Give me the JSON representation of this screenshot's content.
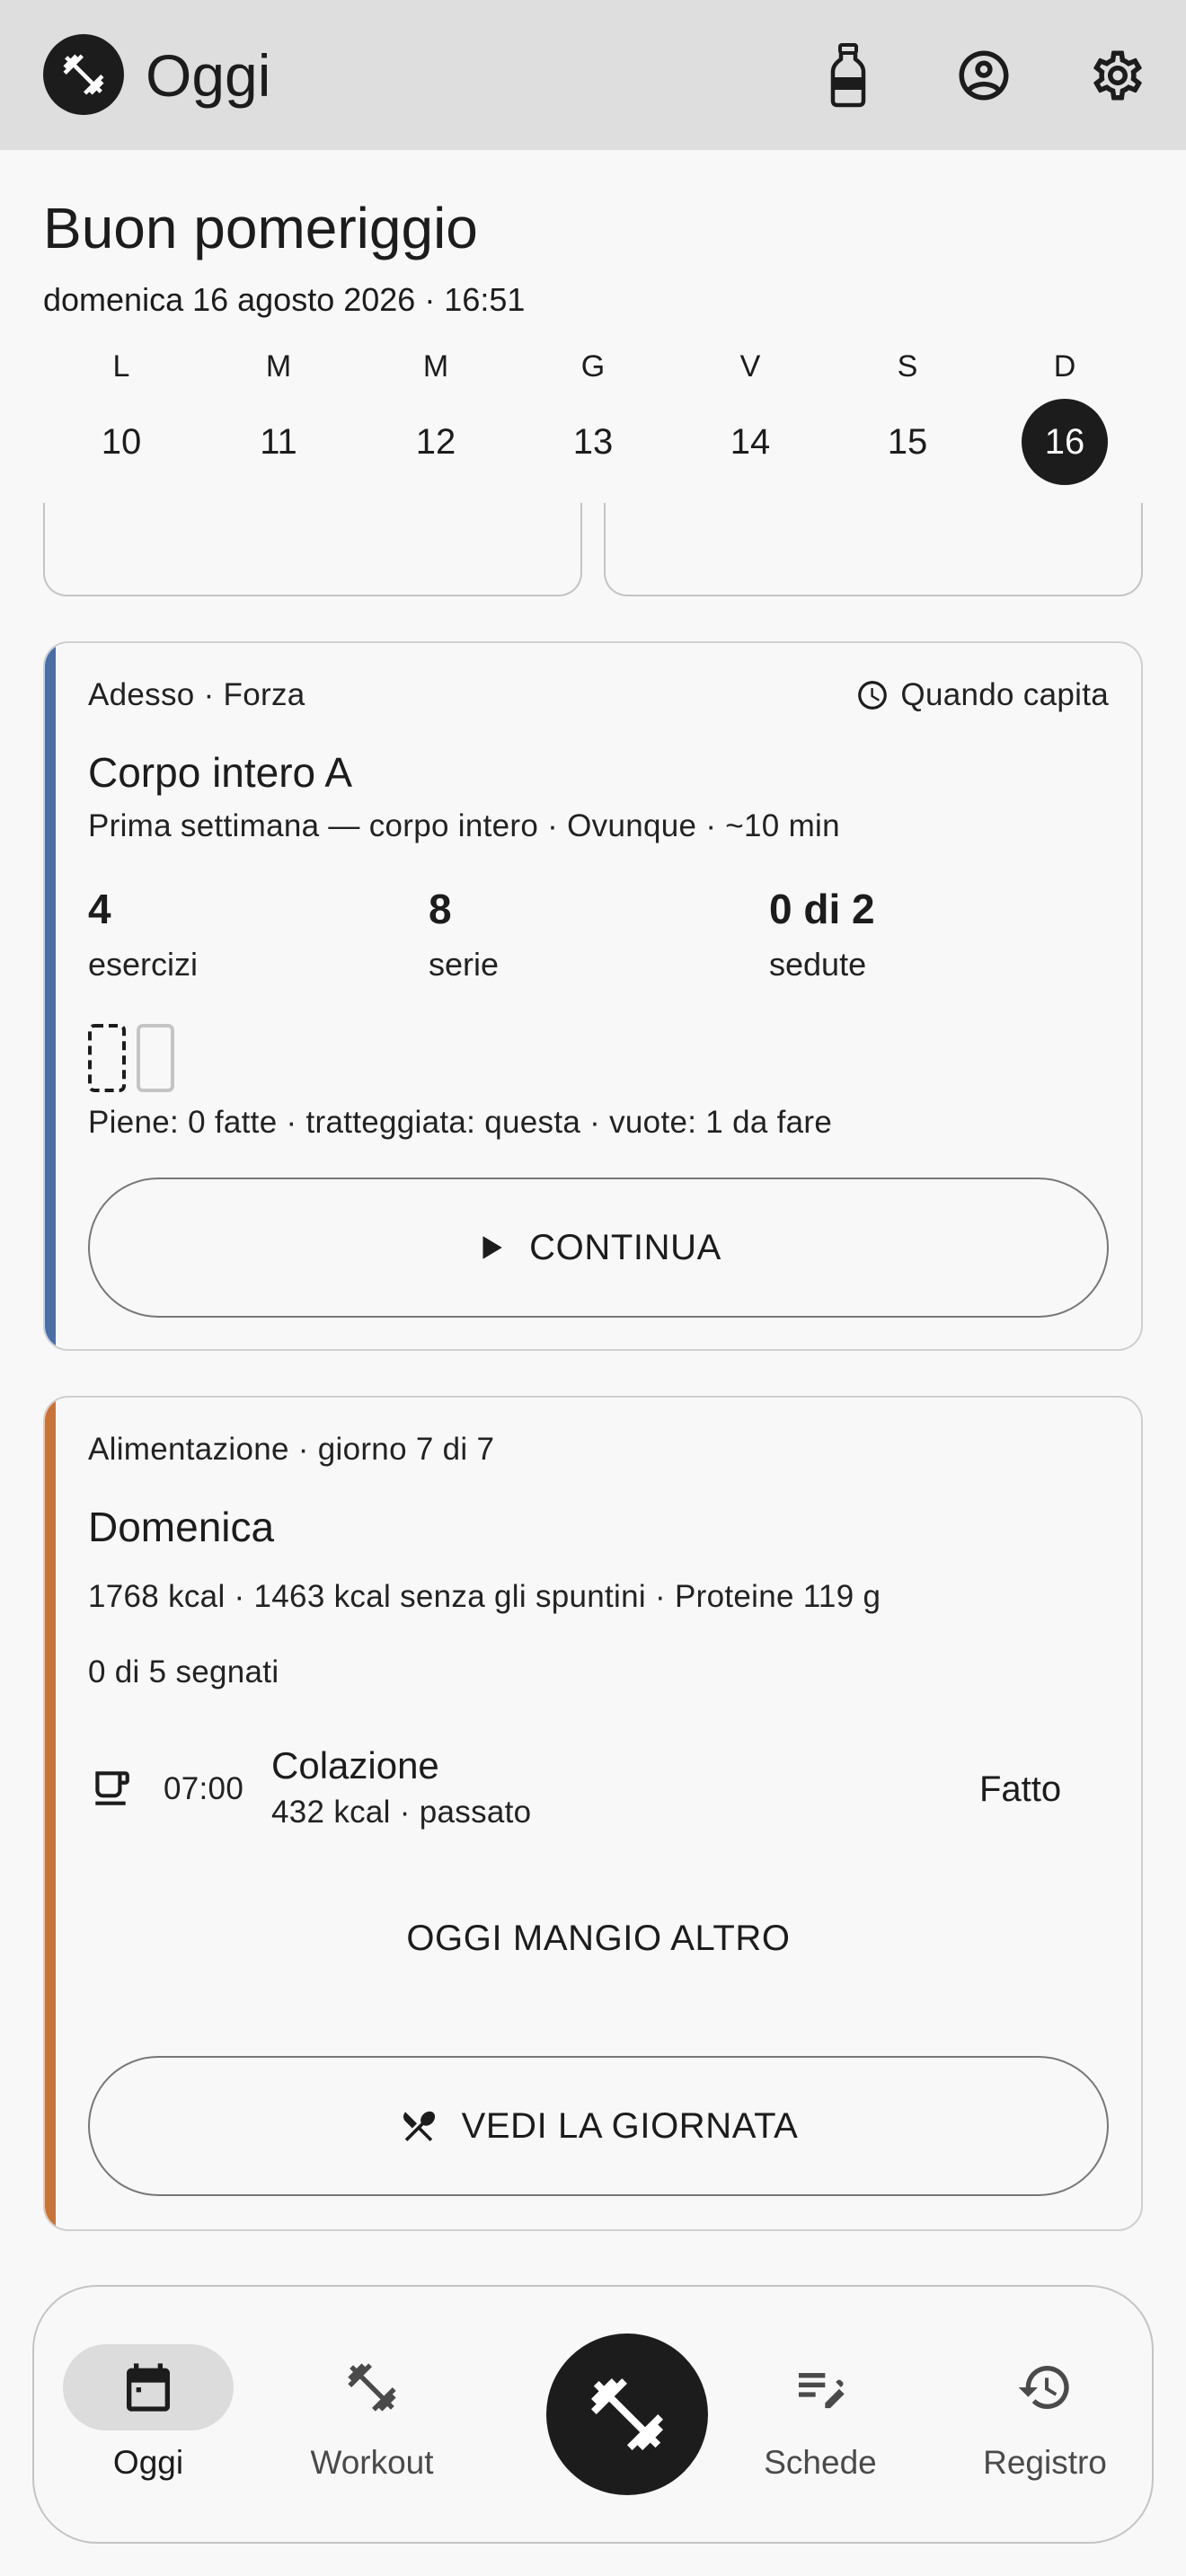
{
  "app_bar": {
    "title": "Oggi",
    "icons": [
      "dumbbell-logo-icon",
      "water-bottle-icon",
      "account-circle-icon",
      "settings-gear-icon"
    ]
  },
  "greeting": {
    "title": "Buon pomeriggio",
    "date": "domenica 16 agosto 2026 · 16:51"
  },
  "week": [
    {
      "letter": "L",
      "num": "10"
    },
    {
      "letter": "M",
      "num": "11"
    },
    {
      "letter": "M",
      "num": "12"
    },
    {
      "letter": "G",
      "num": "13"
    },
    {
      "letter": "V",
      "num": "14"
    },
    {
      "letter": "S",
      "num": "15"
    },
    {
      "letter": "D",
      "num": "16",
      "selected": true
    }
  ],
  "workout_card": {
    "accent": "#4a6fa5",
    "meta": "Adesso · Forza",
    "when": "Quando capita",
    "title": "Corpo intero A",
    "subtitle": "Prima settimana — corpo intero · Ovunque · ~10 min",
    "stats": [
      {
        "value": "4",
        "label": "esercizi"
      },
      {
        "value": "8",
        "label": "serie"
      },
      {
        "value": "0 di 2",
        "label": "sedute"
      }
    ],
    "sessions": {
      "done": 0,
      "current": 1,
      "todo": 1
    },
    "legend": "Piene: 0 fatte · tratteggiata: questa · vuote: 1 da fare",
    "button": "CONTINUA"
  },
  "nutrition_card": {
    "accent": "#c8733a",
    "meta": "Alimentazione · giorno 7 di 7",
    "title": "Domenica",
    "summary": "1768 kcal · 1463 kcal senza gli spuntini · Proteine 119 g",
    "progress": "0 di 5 segnati",
    "meal": {
      "time": "07:00",
      "name": "Colazione",
      "detail": "432 kcal · passato",
      "action": "Fatto",
      "icon": "coffee-cup-icon"
    },
    "text_button": "OGGI MANGIO ALTRO",
    "button": "VEDI LA GIORNATA"
  },
  "bottom_nav": {
    "items": [
      {
        "label": "Oggi",
        "icon": "calendar-today-icon",
        "active": true
      },
      {
        "label": "Workout",
        "icon": "dumbbell-icon"
      },
      {
        "label": "Schede",
        "icon": "edit-list-icon"
      },
      {
        "label": "Registro",
        "icon": "history-icon"
      }
    ],
    "fab_icon": "dumbbell-fab-icon"
  }
}
